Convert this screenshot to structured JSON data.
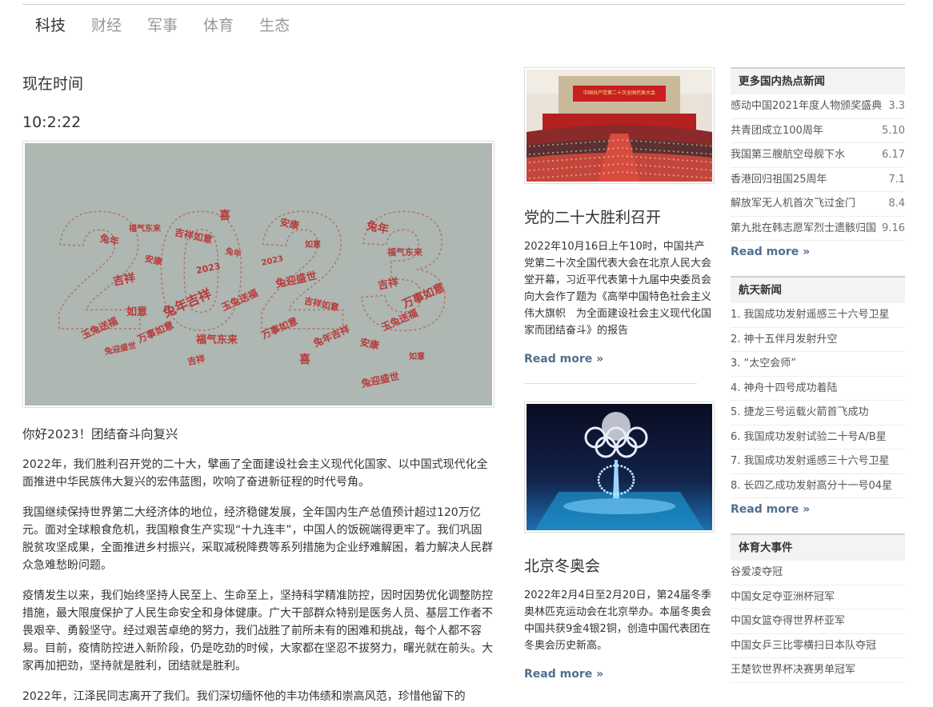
{
  "nav": {
    "items": [
      "科技",
      "财经",
      "军事",
      "体育",
      "生态"
    ],
    "active_index": 0
  },
  "main": {
    "time_label": "现在时间",
    "time_value": "10:2:22",
    "hero_image": {
      "big_text": "2023",
      "word_cloud": [
        "兔年",
        "福气东来",
        "吉祥",
        "玉兔送福",
        "安康",
        "如意",
        "兔迎盛世",
        "万事如意",
        "吉祥如意",
        "喜",
        "2023",
        "兔年吉祥"
      ]
    },
    "article_title": "你好2023！团结奋斗向复兴",
    "paragraphs": [
      "2022年，我们胜利召开党的二十大，擘画了全面建设社会主义现代化国家、以中国式现代化全面推进中华民族伟大复兴的宏伟蓝图，吹响了奋进新征程的时代号角。",
      "我国继续保持世界第二大经济体的地位，经济稳健发展，全年国内生产总值预计超过120万亿元。面对全球粮食危机，我国粮食生产实现“十九连丰”，中国人的饭碗端得更牢了。我们巩固脱贫攻坚成果，全面推进乡村振兴，采取减税降费等系列措施为企业纾难解困，着力解决人民群众急难愁盼问题。",
      "疫情发生以来，我们始终坚持人民至上、生命至上，坚持科学精准防控，因时因势优化调整防控措施，最大限度保护了人民生命安全和身体健康。广大干部群众特别是医务人员、基层工作者不畏艰辛、勇毅坚守。经过艰苦卓绝的努力，我们战胜了前所未有的困难和挑战，每个人都不容易。目前，疫情防控进入新阶段，仍是吃劲的时候，大家都在坚忍不拔努力，曙光就在前头。大家再加把劲，坚持就是胜利，团结就是胜利。",
      "2022年，江泽民同志离开了我们。我们深切缅怀他的丰功伟绩和崇高风范，珍惜他留下的"
    ]
  },
  "cards": [
    {
      "title": "党的二十大胜利召开",
      "text": "2022年10月16日上午10时，中国共产党第二十次全国代表大会在北京人民大会堂开幕，习近平代表第十九届中央委员会向大会作了题为《高举中国特色社会主义伟大旗帜　为全面建设社会主义现代化国家而团结奋斗》的报告",
      "read_more": "Read more »",
      "banner_text": "中国共产党第二十次全国代表大会"
    },
    {
      "title": "北京冬奥会",
      "text": "2022年2月4日至2月20日，第24届冬季奥林匹克运动会在北京举办。本届冬奥会中国共获9金4银2铜，创造中国代表团在冬奥会历史新高。",
      "read_more": "Read more »"
    }
  ],
  "sidebar": {
    "hot": {
      "title": "更多国内热点新闻",
      "items": [
        {
          "text": "感动中国2021年度人物颁奖盛典",
          "num": "3.3"
        },
        {
          "text": "共青团成立100周年",
          "num": "5.10"
        },
        {
          "text": "我国第三艘航空母舰下水",
          "num": "6.17"
        },
        {
          "text": "香港回归祖国25周年",
          "num": "7.1"
        },
        {
          "text": "解放军无人机首次飞过金门",
          "num": "8.4"
        },
        {
          "text": "第九批在韩志愿军烈士遗骸归国",
          "num": "9.16"
        }
      ],
      "more": "Read more »"
    },
    "space": {
      "title": "航天新闻",
      "items": [
        "1. 我国成功发射遥感三十六号卫星",
        "2. 神十五伴月发射升空",
        "3. “太空会师”",
        "4. 神舟十四号成功着陆",
        "5. 捷龙三号运载火箭首飞成功",
        "6. 我国成功发射试验二十号A/B星",
        "7. 我国成功发射遥感三十六号卫星",
        "8. 长四乙成功发射高分十一号04星"
      ],
      "more": "Read more »"
    },
    "sports": {
      "title": "体育大事件",
      "items": [
        "谷爱凌夺冠",
        "中国女足夺亚洲杯冠军",
        "中国女篮夺得世界杯亚军",
        "中国女乒三比零横扫日本队夺冠",
        "王楚钦世界杯决赛男单冠军"
      ]
    }
  },
  "colors": {
    "accent": "#516f8e",
    "word_red": "#b83a3a",
    "hero_bg": "#aeb7b1"
  }
}
